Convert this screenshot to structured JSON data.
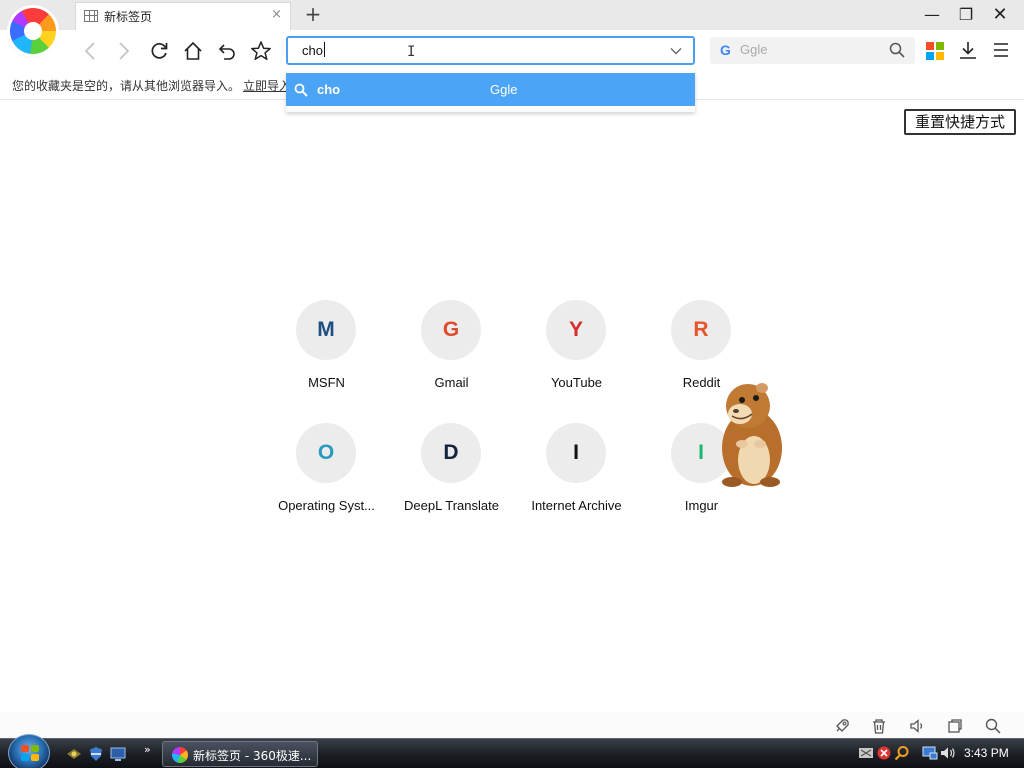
{
  "browser": {
    "tab": {
      "title": "新标签页",
      "close_glyph": "×"
    },
    "new_tab_glyph": "+",
    "window_controls": {
      "minimize": "—",
      "restore": "❐",
      "close": "✕"
    },
    "address_bar": {
      "value": "cho"
    },
    "search_box": {
      "engine_icon": "G",
      "placeholder": "Ggle"
    },
    "bookmarks_bar": {
      "empty_text": "您的收藏夹是空的，请从其他浏览器导入。",
      "import_link": "立即导入"
    },
    "suggestion": {
      "query": "cho",
      "engine": "Ggle"
    },
    "icons": {
      "nav": [
        "back-icon",
        "forward-icon",
        "reload-icon",
        "home-icon",
        "undo-close-icon",
        "star-icon"
      ],
      "toolbar_right": [
        "apps-grid-icon",
        "download-icon",
        "menu-icon"
      ],
      "statusbar": [
        "rocket-icon",
        "trash-icon",
        "speaker-icon",
        "window-icon",
        "search-icon"
      ]
    },
    "colors": {
      "accent": "#4ba4f5",
      "apps": [
        "#f25022",
        "#7fba00",
        "#00a4ef",
        "#ffb900"
      ]
    }
  },
  "page": {
    "reset_button": "重置快捷方式",
    "shortcuts": [
      {
        "letter": "M",
        "label": "MSFN",
        "color": "#1d4f82"
      },
      {
        "letter": "G",
        "label": "Gmail",
        "color": "#e04a2c"
      },
      {
        "letter": "Y",
        "label": "YouTube",
        "color": "#d82b2b"
      },
      {
        "letter": "R",
        "label": "Reddit",
        "color": "#e8542a"
      },
      {
        "letter": "O",
        "label": "Operating Syst...",
        "color": "#2a9bbf"
      },
      {
        "letter": "D",
        "label": "DeepL Translate",
        "color": "#14243d"
      },
      {
        "letter": "I",
        "label": "Internet Archive",
        "color": "#111111"
      },
      {
        "letter": "I",
        "label": "Imgur",
        "color": "#1bb76e"
      }
    ]
  },
  "taskbar": {
    "window_label": "新标签页 - 360极速...",
    "more_glyph": "»",
    "clock": "3:43 PM"
  }
}
